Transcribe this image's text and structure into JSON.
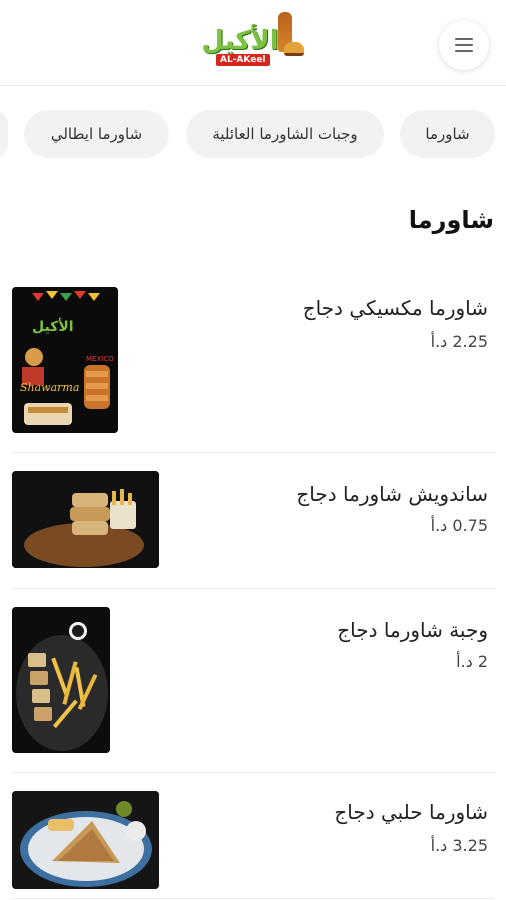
{
  "header": {
    "logo_text": "الأكيل",
    "logo_sub": "AL-AKeel",
    "menu_icon": "hamburger-menu-icon"
  },
  "categories": [
    {
      "label": "شاورما"
    },
    {
      "label": "وجبات الشاورما العائلية"
    },
    {
      "label": "شاورما ايطالي"
    }
  ],
  "section": {
    "title": "شاورما"
  },
  "items": [
    {
      "name": "شاورما مكسيكي دجاج",
      "price": "2.25 د.أ",
      "image": "mexican-shawarma-poster"
    },
    {
      "name": "ساندويش شاورما دجاج",
      "price": "0.75 د.أ",
      "image": "shawarma-sandwich-photo"
    },
    {
      "name": "وجبة شاورما دجاج",
      "price": "2 د.أ",
      "image": "shawarma-meal-photo"
    },
    {
      "name": "شاورما حلبي دجاج",
      "price": "3.25 د.أ",
      "image": "halabi-shawarma-photo"
    }
  ],
  "colors": {
    "pill_bg": "#f1f2f4",
    "logo_green": "#7cc242",
    "logo_red": "#d7261e"
  }
}
